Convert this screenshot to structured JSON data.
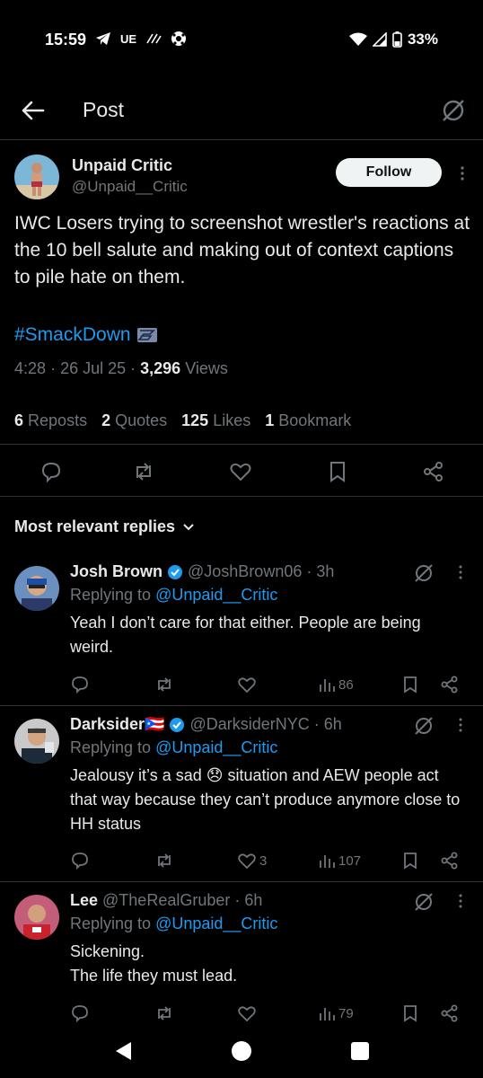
{
  "status_bar": {
    "time": "15:59",
    "carrier": "UE",
    "battery": "33%"
  },
  "topbar": {
    "title": "Post"
  },
  "post": {
    "author_name": "Unpaid Critic",
    "author_handle": "@Unpaid__Critic",
    "follow_label": "Follow",
    "text": "IWC Losers trying to screenshot wrestler's reactions at the 10 bell salute and making out of context captions to pile hate on them.",
    "hashtag": "#SmackDown",
    "time": "4:28",
    "date": "26 Jul 25",
    "views_count": "3,296",
    "views_label": "Views",
    "stats": {
      "reposts_count": "6",
      "reposts_label": "Reposts",
      "quotes_count": "2",
      "quotes_label": "Quotes",
      "likes_count": "125",
      "likes_label": "Likes",
      "bookmarks_count": "1",
      "bookmarks_label": "Bookmark"
    }
  },
  "replies_header": "Most relevant replies",
  "replies": [
    {
      "name": "Josh Brown",
      "handle": "@JoshBrown06",
      "time": "3h",
      "replying_prefix": "Replying to",
      "replying_to": "@Unpaid__Critic",
      "text": "Yeah I don’t care for that either. People are being weird.",
      "likes": "",
      "views": "86"
    },
    {
      "name": "Darksider🇵🇷",
      "handle": "@DarksiderNYC",
      "time": "6h",
      "replying_prefix": "Replying to",
      "replying_to": "@Unpaid__Critic",
      "text": "Jealousy it’s a sad 😞 situation and AEW people act that way because they can’t produce anymore close to HH status",
      "likes": "3",
      "views": "107"
    },
    {
      "name": "Lee",
      "handle": "@TheRealGruber",
      "time": "6h",
      "replying_prefix": "Replying to",
      "replying_to": "@Unpaid__Critic",
      "text": "Sickening.\nThe life they must lead.",
      "likes": "",
      "views": "79"
    }
  ],
  "colors": {
    "background": "#000000",
    "text": "#e7e9ea",
    "muted": "#71767b",
    "accent": "#1d9bf0",
    "divider": "#2f3336"
  }
}
